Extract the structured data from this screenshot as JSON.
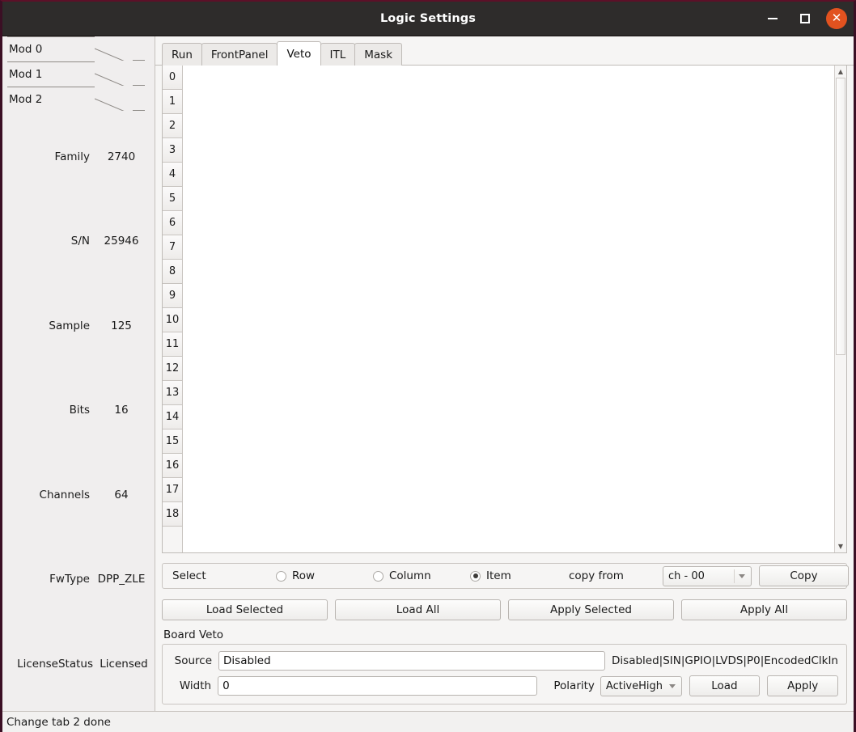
{
  "window": {
    "title": "Logic Settings",
    "buttons": {
      "minimize": "minimize-icon",
      "maximize": "maximize-icon",
      "close": "✕"
    },
    "accent_close": "#e2521f",
    "titlebar_bg": "#2e2c2b",
    "frame_border": "#3b0f24"
  },
  "sidebar": {
    "mod_tabs": [
      {
        "label": "Mod 0",
        "selected": false
      },
      {
        "label": "Mod 1",
        "selected": false
      },
      {
        "label": "Mod 2",
        "selected": true
      }
    ],
    "info": [
      {
        "key": "Family",
        "value": "2740"
      },
      {
        "key": "S/N",
        "value": "25946"
      },
      {
        "key": "Sample",
        "value": "125"
      },
      {
        "key": "Bits",
        "value": "16"
      },
      {
        "key": "Channels",
        "value": "64"
      },
      {
        "key": "FwType",
        "value": "DPP_ZLE"
      },
      {
        "key": "LicenseStatus",
        "value": "Licensed"
      }
    ]
  },
  "tabs": [
    {
      "label": "Run",
      "active": false
    },
    {
      "label": "FrontPanel",
      "active": false
    },
    {
      "label": "Veto",
      "active": true
    },
    {
      "label": "ITL",
      "active": false
    },
    {
      "label": "Mask",
      "active": false
    }
  ],
  "table": {
    "row_headers": [
      "0",
      "1",
      "2",
      "3",
      "4",
      "5",
      "6",
      "7",
      "8",
      "9",
      "10",
      "11",
      "12",
      "13",
      "14",
      "15",
      "16",
      "17",
      "18"
    ],
    "cells": []
  },
  "scrollbar": {
    "up_arrow": "▲",
    "down_arrow": "▼",
    "thumb_position_pct": 0,
    "thumb_size_pct": 60
  },
  "select_bar": {
    "label": "Select",
    "options": [
      {
        "label": "Row",
        "selected": false
      },
      {
        "label": "Column",
        "selected": false
      },
      {
        "label": "Item",
        "selected": true
      }
    ],
    "copy_from_label": "copy from",
    "channel_combo_value": "ch - 00",
    "copy_button": "Copy"
  },
  "actions": {
    "load_selected": "Load Selected",
    "load_all": "Load All",
    "apply_selected": "Apply Selected",
    "apply_all": "Apply All"
  },
  "board_veto": {
    "group_label": "Board Veto",
    "source_label": "Source",
    "source_value": "Disabled",
    "source_hint": "Disabled|SIN|GPIO|LVDS|P0|EncodedClkIn",
    "width_label": "Width",
    "width_value": "0",
    "polarity_label": "Polarity",
    "polarity_value": "ActiveHigh",
    "load_button": "Load",
    "apply_button": "Apply"
  },
  "statusbar": {
    "message": "Change tab 2 done"
  }
}
